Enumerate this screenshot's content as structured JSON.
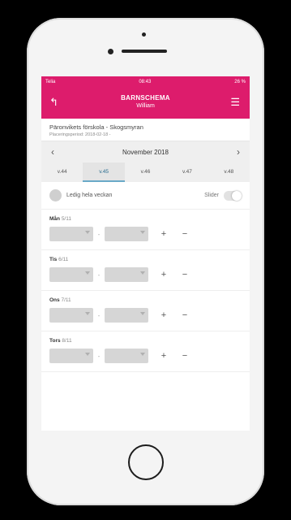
{
  "status": {
    "carrier": "Telia",
    "time": "08:43",
    "battery": "26 %"
  },
  "app": {
    "title": "BARNSCHEMA",
    "subtitle": "William"
  },
  "school": {
    "name": "Päronvikets förskola - Skogsmyran",
    "period": "Placeringsperiod: 2018-02-18 -"
  },
  "calendar": {
    "month": "November 2018",
    "weeks": [
      "v.44",
      "v.45",
      "v.46",
      "v.47",
      "v.48"
    ],
    "active_week": "v.45"
  },
  "ledig": {
    "label": "Ledig hela veckan",
    "slider_label": "Slider"
  },
  "days": [
    {
      "name": "Mån",
      "date": "5/11"
    },
    {
      "name": "Tis",
      "date": "6/11"
    },
    {
      "name": "Ons",
      "date": "7/11"
    },
    {
      "name": "Tors",
      "date": "8/11"
    }
  ],
  "controls": {
    "separator": "-",
    "plus": "+",
    "minus": "−"
  },
  "colors": {
    "brand": "#dd1c6c",
    "active_week_accent": "#6aa9c8"
  }
}
